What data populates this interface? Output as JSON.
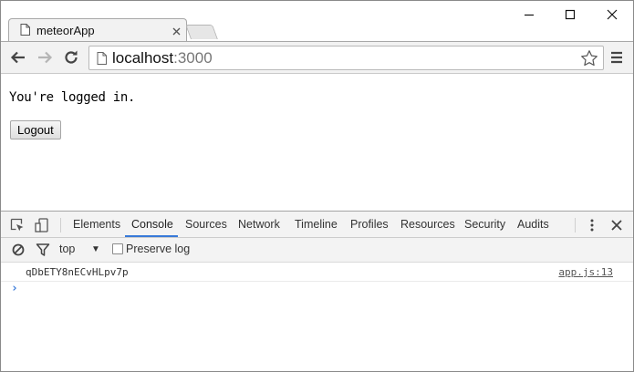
{
  "browser": {
    "tab_title": "meteorApp",
    "url_host": "localhost",
    "url_port": ":3000"
  },
  "page": {
    "status_text": "You're logged in.",
    "logout_label": "Logout"
  },
  "devtools": {
    "tabs": [
      "Elements",
      "Console",
      "Sources",
      "Network",
      "Timeline",
      "Profiles",
      "Resources",
      "Security",
      "Audits"
    ],
    "active_tab": "Console",
    "context": "top",
    "preserve_log_label": "Preserve log",
    "preserve_log_checked": false,
    "console_messages": [
      {
        "text": "qDbETY8nECvHLpv7p",
        "source": "app.js:13"
      }
    ],
    "prompt_symbol": "›"
  },
  "colors": {
    "accent": "#3879d9",
    "toolbar_bg": "#f2f2f2"
  }
}
